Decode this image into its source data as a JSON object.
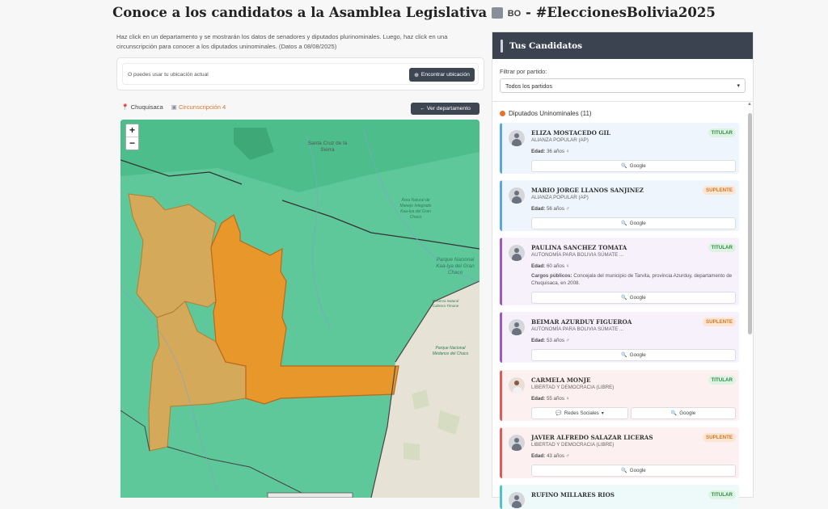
{
  "header": {
    "title_text": "Conoce a los candidatos a la Asamblea Legislativa",
    "flag_code": "BO",
    "hashtag": "#EleccionesBolivia2025"
  },
  "intro": {
    "text": "Haz click en un departamento y se mostrarán los datos de senadores y diputados plurinominales. Luego, haz click en una circunscripción para conocer a los diputados uninominales. (Datos a 08/08/2025)"
  },
  "location": {
    "hint": "O puedes usar tu ubicación actual",
    "button_label": "Encontrar ubicación"
  },
  "breadcrumb": {
    "department": "Chuquisaca",
    "circumscription": "Circunscripción 4",
    "back_button": "← Ver departamento"
  },
  "map": {
    "zoom_in": "+",
    "zoom_out": "−",
    "labels": {
      "santa_cruz": "Santa Cruz de la Sierra",
      "area_natural": "Área Natural de Manejo Integrado Kaa-Iya del Gran Chaco",
      "parque_kaa_iya": "Parque Nacional Kaa-Iya del Gran Chaco",
      "parque_medanos": "Parque Nacional Médanos del Chaco",
      "reserva": "Reserva Natural Cabrera Timane"
    },
    "colors": {
      "base": "#5ec89a",
      "selected": "#e8982a",
      "dimmed": "#d4a95a",
      "paraguay": "#e6e2d6"
    }
  },
  "panel": {
    "title": "Tus Candidatos",
    "filter_label": "Filtrar por partido:",
    "filter_value": "Todos los partidos",
    "section_title": "Diputados Uninominales (11)",
    "candidates": [
      {
        "name": "ELIZA MOSTACEDO GIL",
        "party": "ALIANZA POPULAR (AP)",
        "age": "36 años",
        "gender": "♀",
        "role": "TITULAR",
        "google": "Google",
        "accent": "#5aa7e0",
        "bg": "#eef5fd"
      },
      {
        "name": "MARIO JORGE LLANOS SANJINEZ",
        "party": "ALIANZA POPULAR (AP)",
        "age": "56 años",
        "gender": "♂",
        "role": "SUPLENTE",
        "google": "Google",
        "accent": "#5aa7e0",
        "bg": "#eef5fd"
      },
      {
        "name": "PAULINA SANCHEZ TOMATA",
        "party": "AUTONOMÍA PARA BOLIVIA SÚMATE ...",
        "age": "60 años",
        "gender": "♀",
        "role": "TITULAR",
        "google": "Google",
        "accent": "#9b59c6",
        "bg": "#f7f1fc",
        "cargos_label": "Cargos públicos:",
        "cargos_text": "Concejala del municipio de Tarvita, provincia Azurduy, departamento de Chuquisaca, en 2008."
      },
      {
        "name": "BEIMAR AZURDUY FIGUEROA",
        "party": "AUTONOMÍA PARA BOLIVIA SÚMATE ...",
        "age": "53 años",
        "gender": "♂",
        "role": "SUPLENTE",
        "google": "Google",
        "accent": "#9b59c6",
        "bg": "#f7f1fc"
      },
      {
        "name": "CARMELA MONJE",
        "party": "LIBERTAD Y DEMOCRACIA (LIBRE)",
        "age": "55 años",
        "gender": "♀",
        "role": "TITULAR",
        "social": "Redes Sociales",
        "google": "Google",
        "accent": "#e05a5a",
        "bg": "#fdf0f0"
      },
      {
        "name": "JAVIER ALFREDO SALAZAR LICERAS",
        "party": "LIBERTAD Y DEMOCRACIA (LIBRE)",
        "age": "43 años",
        "gender": "♂",
        "role": "SUPLENTE",
        "google": "Google",
        "accent": "#e05a5a",
        "bg": "#fdf0f0"
      },
      {
        "name": "RUFINO MILLARES RIOS",
        "party": "",
        "age": "",
        "gender": "",
        "role": "TITULAR",
        "google": "",
        "accent": "#4fc3c9",
        "bg": "#eefafa"
      }
    ],
    "age_label": "Edad:"
  }
}
